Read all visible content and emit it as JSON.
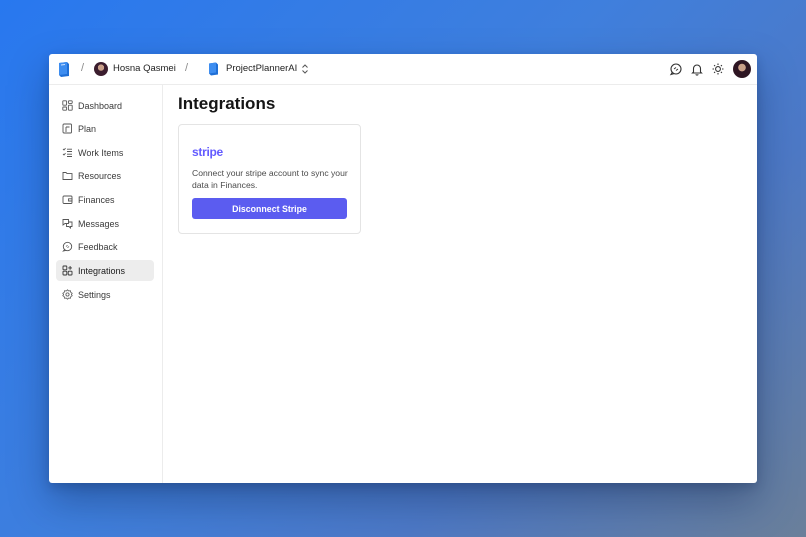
{
  "breadcrumb": {
    "separator": "/",
    "user_name": "Hosna Qasmei",
    "project_name": "ProjectPlannerAI"
  },
  "header_icons": [
    "feedback-icon",
    "bell-icon",
    "sun-icon",
    "avatar"
  ],
  "sidebar": {
    "items": [
      {
        "label": "Dashboard",
        "icon": "dashboard-icon",
        "active": false
      },
      {
        "label": "Plan",
        "icon": "plan-icon",
        "active": false
      },
      {
        "label": "Work Items",
        "icon": "work-items-icon",
        "active": false
      },
      {
        "label": "Resources",
        "icon": "folder-icon",
        "active": false
      },
      {
        "label": "Finances",
        "icon": "wallet-icon",
        "active": false
      },
      {
        "label": "Messages",
        "icon": "messages-icon",
        "active": false
      },
      {
        "label": "Feedback",
        "icon": "feedback-icon",
        "active": false
      },
      {
        "label": "Integrations",
        "icon": "integrations-icon",
        "active": true
      },
      {
        "label": "Settings",
        "icon": "gear-icon",
        "active": false
      }
    ]
  },
  "main": {
    "title": "Integrations",
    "stripe_card": {
      "logo_text": "stripe",
      "description": "Connect your stripe account to sync your data in Finances.",
      "button_label": "Disconnect Stripe"
    }
  },
  "colors": {
    "accent": "#5b5cf0",
    "stripe_brand": "#635bff",
    "active_nav_bg": "#ededed"
  }
}
